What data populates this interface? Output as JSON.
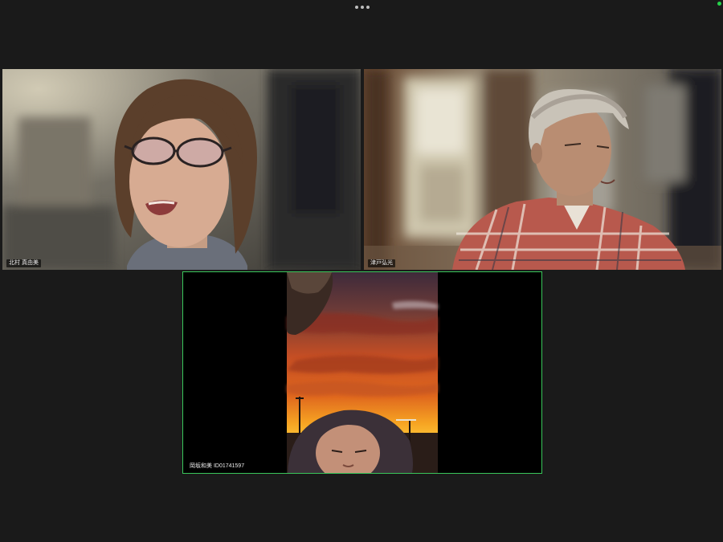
{
  "app": {
    "toolbar": {
      "more_options_icon": "ellipsis-horizontal-icon"
    },
    "status": {
      "connection_color": "#26d14a"
    }
  },
  "participants": [
    {
      "name": "北村 真由美",
      "active_speaker": false
    },
    {
      "name": "津戸弘光",
      "active_speaker": false
    },
    {
      "name": "岡坂和美 ID01741597",
      "active_speaker": true
    }
  ],
  "colors": {
    "active_speaker_border": "#39c65a",
    "background": "#1a1a1a"
  }
}
